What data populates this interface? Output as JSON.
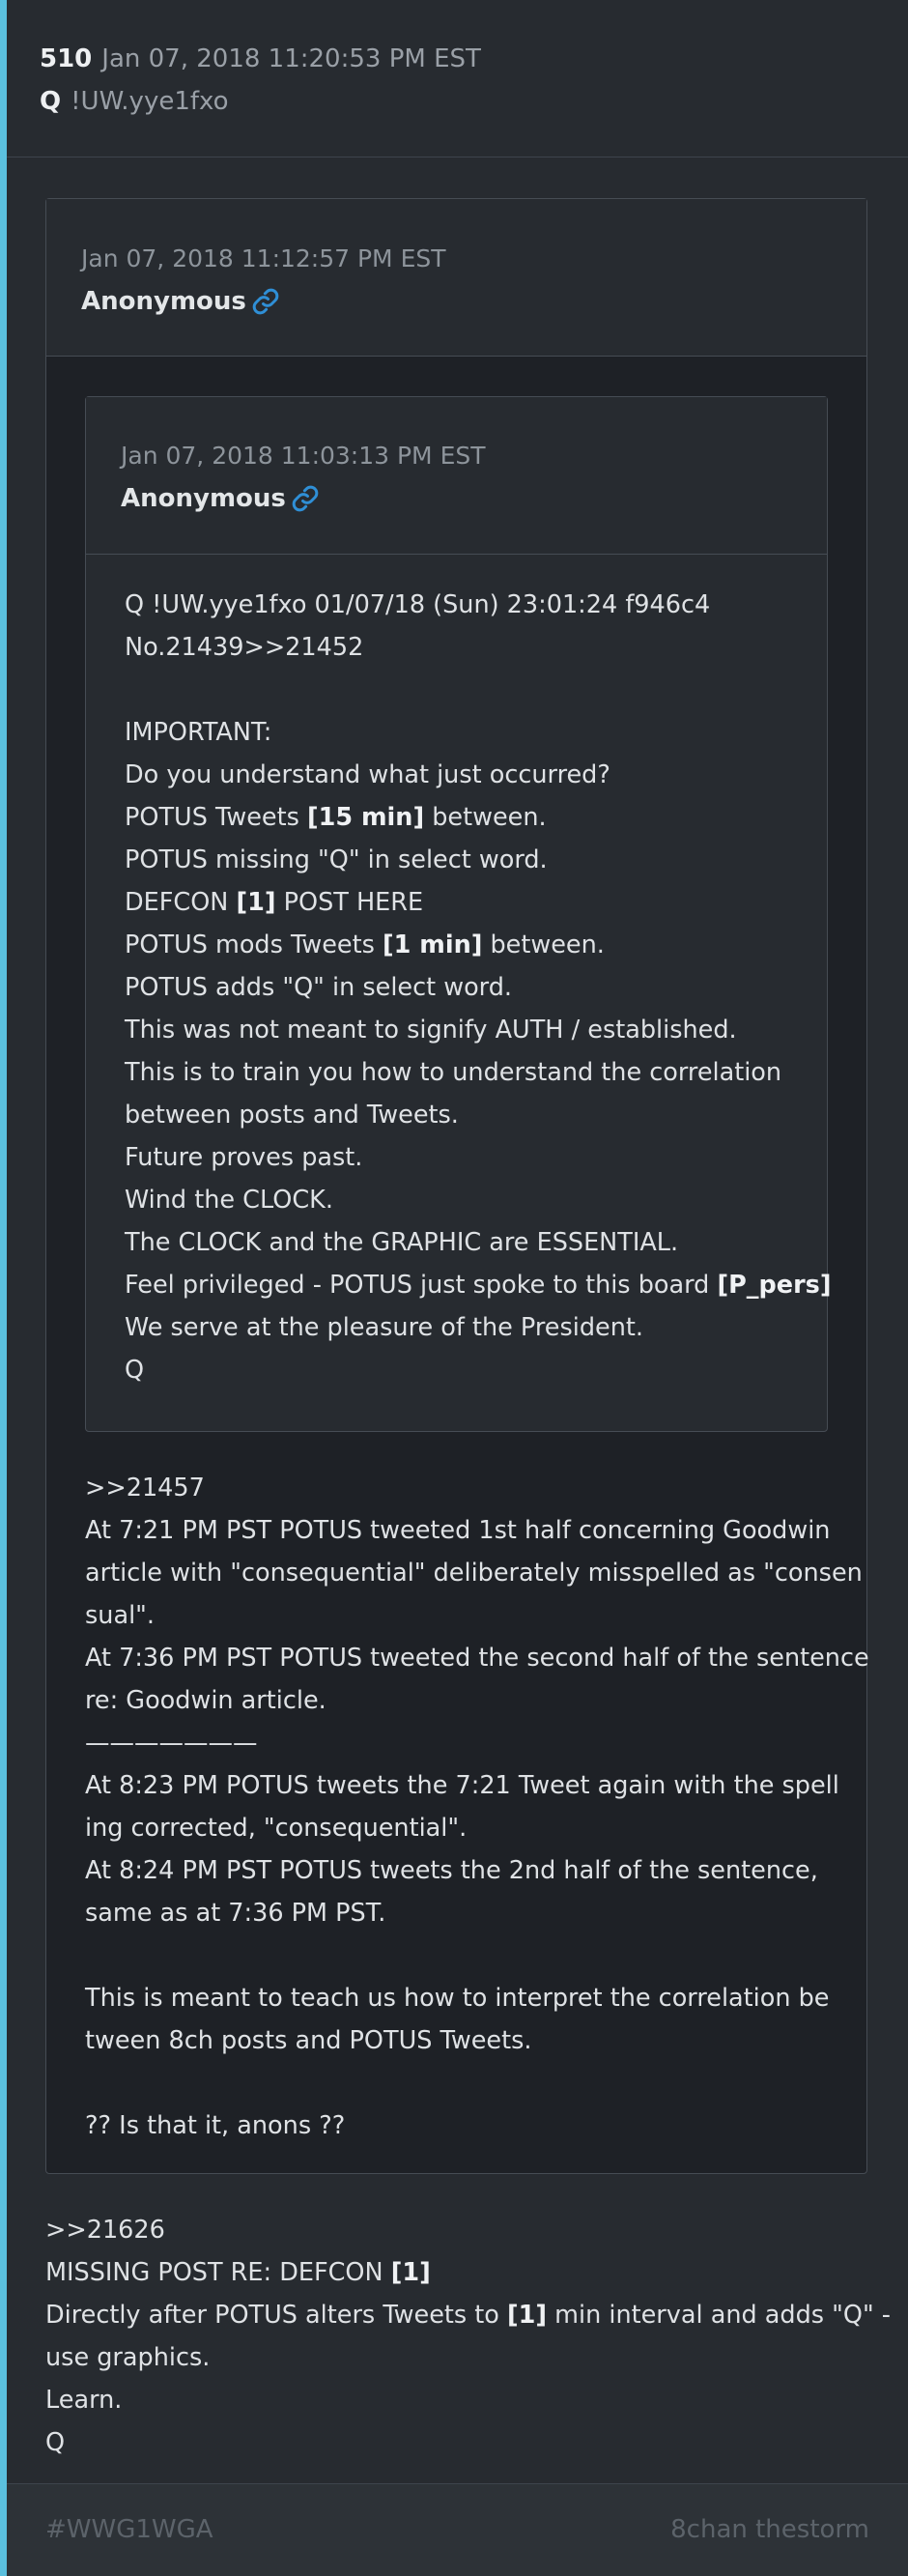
{
  "post": {
    "number": "510",
    "date": "Jan 07, 2018 11:20:53 PM EST",
    "author": "Q",
    "tripcode": "!UW.yye1fxo",
    "accent_color": "#5bc0de"
  },
  "quote1": {
    "date": "Jan 07, 2018 11:12:57 PM EST",
    "author": "Anonymous",
    "link_icon": "link-icon"
  },
  "quote2": {
    "date": "Jan 07, 2018 11:03:13 PM EST",
    "author": "Anonymous",
    "link_icon": "link-icon",
    "lines": [
      {
        "text": "Q !UW.yye1fxo  01/07/18 (Sun) 23:01:24 f946c4"
      },
      {
        "text": "No.21439>>21452"
      },
      {
        "text": ""
      },
      {
        "text": "IMPORTANT:"
      },
      {
        "text": "Do you understand what just occurred?"
      },
      {
        "pre": "POTUS Tweets ",
        "bold": "[15 min]",
        "post": " between."
      },
      {
        "text": "POTUS missing \"Q\" in select word."
      },
      {
        "pre": "DEFCON ",
        "bold": "[1]",
        "post": " POST HERE"
      },
      {
        "pre": "POTUS mods Tweets ",
        "bold": "[1 min]",
        "post": " between."
      },
      {
        "text": "POTUS adds \"Q\" in select word."
      },
      {
        "text": "This was not meant to signify AUTH / established."
      },
      {
        "text": "This is to train you how to understand the correlation"
      },
      {
        "text": "between posts and Tweets."
      },
      {
        "text": "Future proves past."
      },
      {
        "text": "Wind the CLOCK."
      },
      {
        "text": "The CLOCK and the GRAPHIC are ESSENTIAL."
      },
      {
        "pre": "Feel privileged - POTUS just spoke to this board ",
        "bold": "[P_pers]",
        "post": ""
      },
      {
        "text": "We serve at the pleasure of the President."
      },
      {
        "text": "Q"
      }
    ]
  },
  "quote1_body": {
    "lines": [
      {
        "text": ">>21457"
      },
      {
        "text": "At 7:21 PM PST POTUS tweeted 1st half concerning Goodwin"
      },
      {
        "text": "article with \"consequential\" deliberately misspelled as \"consen"
      },
      {
        "text": "sual\"."
      },
      {
        "text": "At 7:36 PM PST POTUS tweeted the second half of the sentence"
      },
      {
        "text": "re: Goodwin article."
      },
      {
        "text": "———————"
      },
      {
        "text": "At 8:23 PM POTUS tweets the 7:21 Tweet again with the spell"
      },
      {
        "text": "ing corrected, \"consequential\"."
      },
      {
        "text": "At 8:24 PM PST POTUS tweets the 2nd half of the sentence,"
      },
      {
        "text": "same as at 7:36 PM PST."
      },
      {
        "text": ""
      },
      {
        "text": "This is meant to teach us how to interpret the correlation be"
      },
      {
        "text": "tween 8ch posts and POTUS Tweets."
      },
      {
        "text": ""
      },
      {
        "text": "??  Is that it, anons ??"
      }
    ]
  },
  "main_body": {
    "lines": [
      {
        "text": ">>21626"
      },
      {
        "pre": "MISSING POST RE: DEFCON ",
        "bold": "[1]",
        "post": ""
      },
      {
        "pre": "Directly after POTUS alters Tweets to ",
        "bold": "[1]",
        "post": " min interval and adds \"Q\" -"
      },
      {
        "text": "use graphics."
      },
      {
        "text": "Learn."
      },
      {
        "text": "Q"
      }
    ]
  },
  "footer": {
    "tag": "#WWG1WGA",
    "board": "8chan thestorm"
  }
}
